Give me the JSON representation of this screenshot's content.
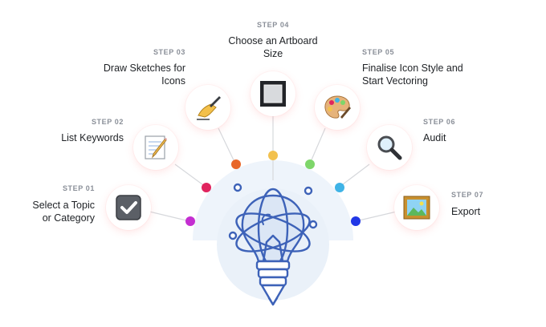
{
  "steps": [
    {
      "num": "STEP 01",
      "title_lines": [
        "Select a Topic",
        "or Category"
      ],
      "icon": "checkbox-icon",
      "dot_color": "#c42ed1"
    },
    {
      "num": "STEP 02",
      "title_lines": [
        "List Keywords"
      ],
      "icon": "memo-icon",
      "dot_color": "#e0245e"
    },
    {
      "num": "STEP 03",
      "title_lines": [
        "Draw Sketches for",
        "Icons"
      ],
      "icon": "writing-hand-icon",
      "dot_color": "#e8672a"
    },
    {
      "num": "STEP 04",
      "title_lines": [
        "Choose an Artboard",
        "Size"
      ],
      "icon": "black-square-button-icon",
      "dot_color": "#f2c14e"
    },
    {
      "num": "STEP 05",
      "title_lines": [
        "Finalise Icon Style and",
        "Start Vectoring"
      ],
      "icon": "artist-palette-icon",
      "dot_color": "#7ed66a"
    },
    {
      "num": "STEP 06",
      "title_lines": [
        "Audit"
      ],
      "icon": "magnifying-glass-icon",
      "dot_color": "#3fb3e6"
    },
    {
      "num": "STEP 07",
      "title_lines": [
        "Export"
      ],
      "icon": "framed-picture-icon",
      "dot_color": "#2137e6"
    }
  ],
  "center": {
    "icon": "lightbulb-atom-icon",
    "accent": "#3d62b8"
  }
}
